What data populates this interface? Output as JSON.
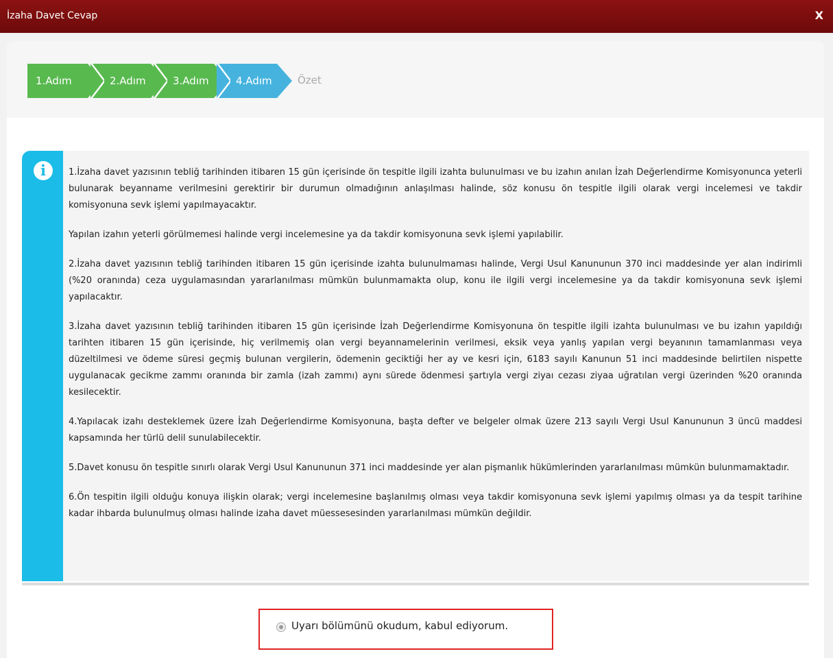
{
  "window": {
    "title": "İzaha Davet Cevap",
    "close_label": "X"
  },
  "steps": [
    {
      "label": "1.Adım",
      "state": "done"
    },
    {
      "label": "2.Adım",
      "state": "done"
    },
    {
      "label": "3.Adım",
      "state": "done"
    },
    {
      "label": "4.Adım",
      "state": "current"
    },
    {
      "label": "Özet",
      "state": "pending"
    }
  ],
  "colors": {
    "titlebar": "#7d0e0e",
    "step_done": "#58b94f",
    "step_current": "#46b3de",
    "info_stripe": "#1bbce8",
    "highlight_border": "#e02424"
  },
  "info": {
    "icon": "info-icon",
    "paragraphs": [
      "1.İzaha davet yazısının tebliğ tarihinden itibaren 15 gün içerisinde ön tespitle ilgili izahta bulunulması ve bu izahın anılan İzah Değerlendirme Komisyonunca yeterli bulunarak beyanname verilmesini gerektirir bir durumun olmadığının anlaşılması halinde, söz konusu ön tespitle ilgili olarak vergi incelemesi ve takdir komisyonuna sevk işlemi yapılmayacaktır.",
      "Yapılan izahın yeterli görülmemesi halinde vergi incelemesine ya da takdir komisyonuna sevk işlemi yapılabilir.",
      "2.İzaha davet yazısının tebliğ tarihinden itibaren 15 gün içerisinde izahta bulunulmaması halinde, Vergi Usul Kanununun 370 inci maddesinde yer alan indirimli (%20 oranında) ceza uygulamasından yararlanılması mümkün bulunmamakta olup, konu ile ilgili vergi incelemesine ya da takdir komisyonuna sevk işlemi yapılacaktır.",
      "3.İzaha davet yazısının tebliğ tarihinden itibaren 15 gün içerisinde İzah Değerlendirme Komisyonuna ön tespitle ilgili izahta bulunulması ve bu izahın yapıldığı tarihten itibaren 15 gün içerisinde, hiç verilmemiş olan vergi beyannamelerinin verilmesi, eksik veya yanlış yapılan vergi beyanının tamamlanması veya düzeltilmesi ve ödeme süresi geçmiş bulunan vergilerin, ödemenin geciktiği her ay ve kesri için, 6183 sayılı Kanunun 51 inci maddesinde belirtilen nispette uygulanacak gecikme zammı oranında bir zamla (izah zammı) aynı sürede ödenmesi şartıyla vergi ziyaı cezası ziyaa uğratılan vergi üzerinden %20 oranında kesilecektir.",
      "4.Yapılacak izahı desteklemek üzere İzah Değerlendirme Komisyonuna, başta defter ve belgeler olmak üzere 213 sayılı Vergi Usul Kanununun 3 üncü maddesi kapsamında her türlü delil sunulabilecektir.",
      "5.Davet konusu ön tespitle sınırlı olarak Vergi Usul Kanununun 371 inci maddesinde yer alan pişmanlık hükümlerinden yararlanılması mümkün bulunmamaktadır.",
      "6.Ön tespitin ilgili olduğu konuya ilişkin olarak; vergi incelemesine başlanılmış olması veya takdir komisyonuna sevk işlemi yapılmış olması ya da tespit tarihine kadar ihbarda bulunulmuş olması halinde izaha davet müessesesinden yararlanılması mümkün değildir."
    ]
  },
  "acknowledgement": {
    "label": "Uyarı bölümünü okudum, kabul ediyorum.",
    "selected": false
  }
}
